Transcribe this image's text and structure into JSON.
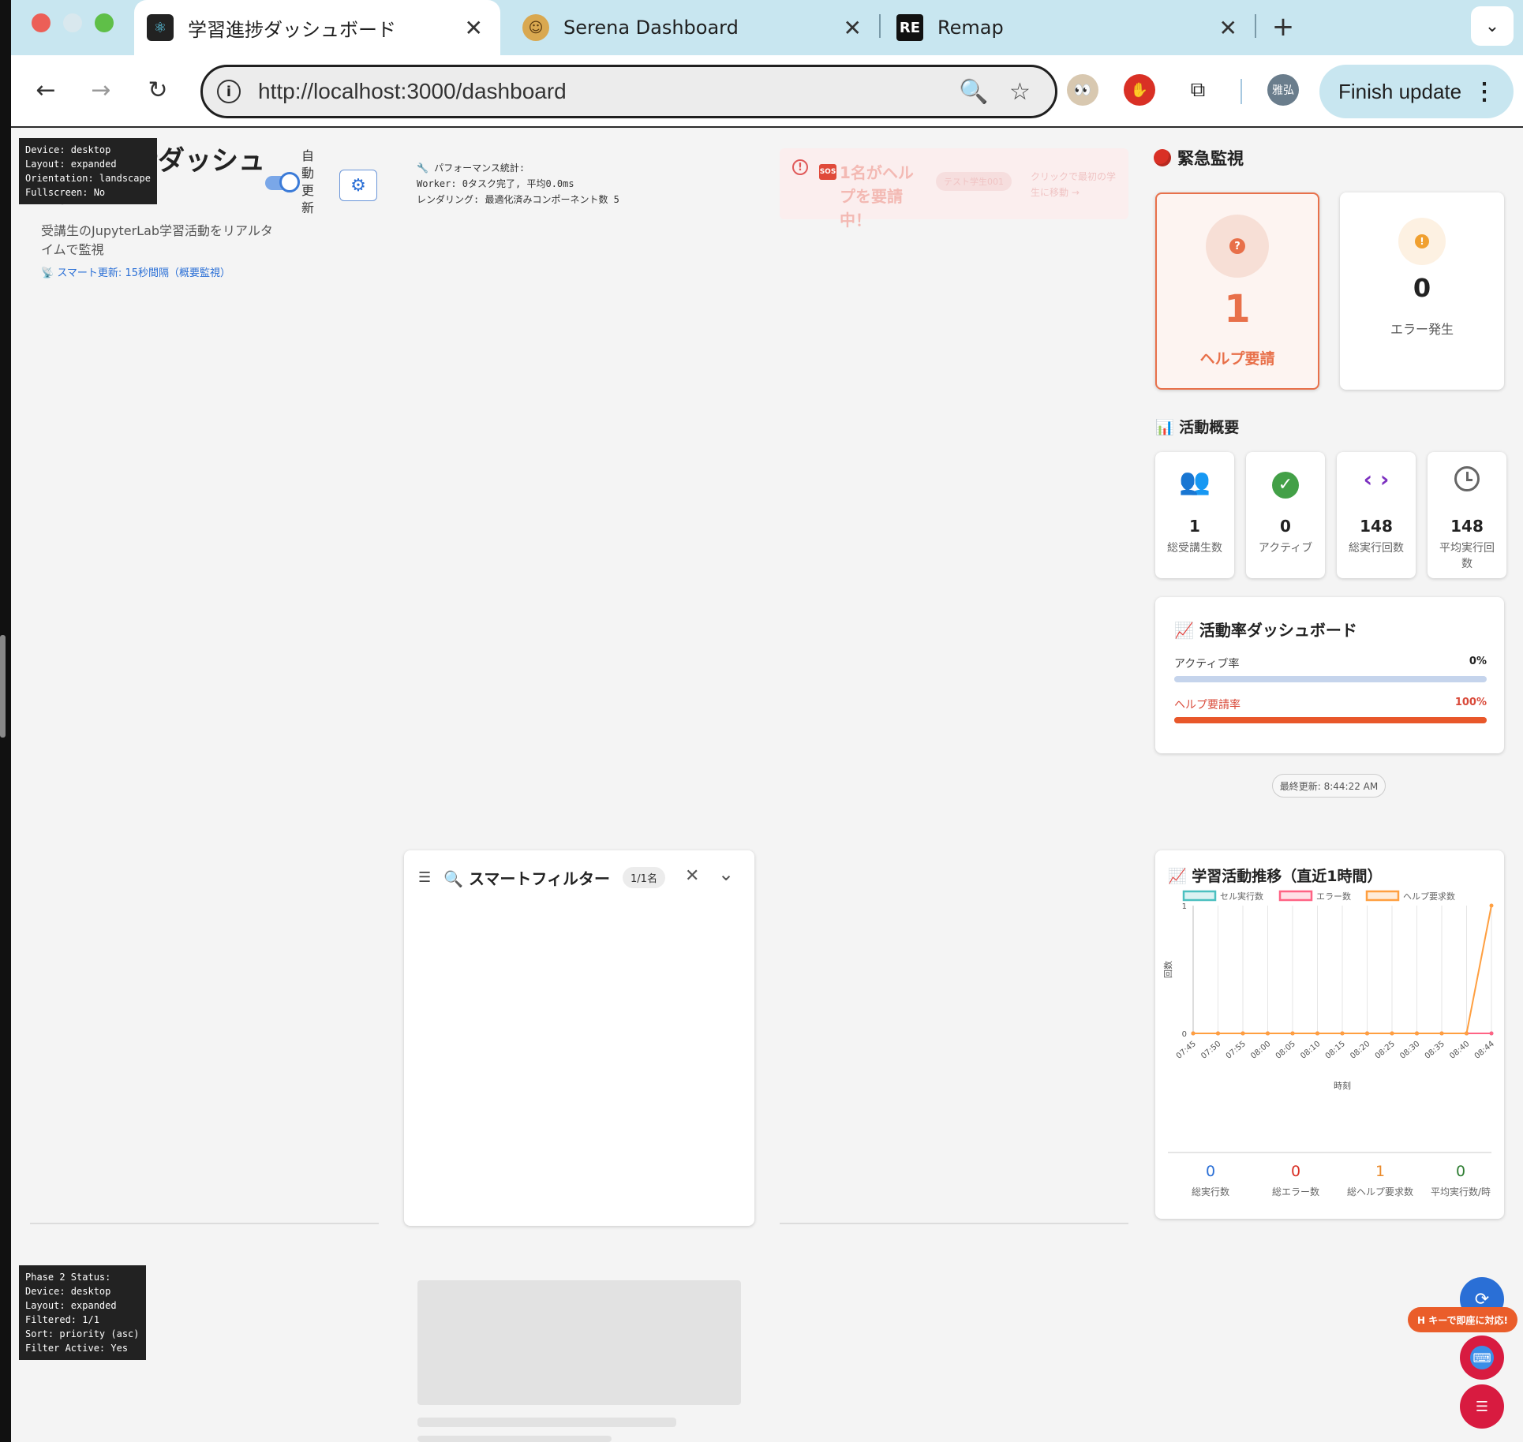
{
  "browser": {
    "tabs": [
      {
        "title": "学習進捗ダッシュボード",
        "active": true
      },
      {
        "title": "Serena Dashboard",
        "active": false
      },
      {
        "title": "Remap",
        "active": false
      }
    ],
    "new_tab": "+",
    "url": "http://localhost:3000/dashboard",
    "profile_initials": "雅弘",
    "finish_update": "Finish update",
    "remap_favicon": "RE"
  },
  "debug_top": "Device: desktop\nLayout: expanded\nOrientation: landscape\nFullscreen: No",
  "debug_bottom": "Phase 2 Status:\nDevice: desktop\nLayout: expanded\nFiltered: 1/1\nSort: priority (asc)\nFilter Active: Yes",
  "header": {
    "title": "学習進捗ダッシュボード",
    "subtitle": "受講生のJupyterLab学習活動をリアルタイムで監視",
    "smart_update": "📡 スマート更新: 15秒間隔（概要監視）",
    "auto_update": "自動更新"
  },
  "perf": "🔧 パフォーマンス統計:\nWorker: 0タスク完了, 平均0.0ms\nレンダリング: 最適化済みコンポーネント数 5",
  "alert": {
    "message": "1名がヘルプを要請中！",
    "student_chip": "テスト学生001",
    "hint": "クリックで最初の学生に移動 →"
  },
  "emergency": {
    "title": "緊急監視",
    "help_count": "1",
    "help_label": "ヘルプ要請",
    "error_count": "0",
    "error_label": "エラー発生"
  },
  "activity": {
    "title": "📊 活動概要",
    "stats": [
      {
        "value": "1",
        "label": "総受講生数",
        "icon": "people-icon",
        "color": "#3b6fd6"
      },
      {
        "value": "0",
        "label": "アクティブ",
        "icon": "check-circle-icon",
        "color": "#43a047"
      },
      {
        "value": "148",
        "label": "総実行回数",
        "icon": "code-icon",
        "color": "#7b2fbf"
      },
      {
        "value": "148",
        "label": "平均実行回数",
        "icon": "clock-icon",
        "color": "#666666"
      }
    ]
  },
  "rate_dashboard": {
    "title": "📈 活動率ダッシュボード",
    "active_label": "アクティブ率",
    "active_value": "0%",
    "active_fraction": 0,
    "help_label": "ヘルプ要請率",
    "help_value": "100%",
    "help_fraction": 1
  },
  "last_updated": "最終更新: 8:44:22 AM",
  "filter": {
    "title": "🔍 スマートフィルター",
    "badge": "1/1名"
  },
  "h_key_hint": "H キーで即座に対応!",
  "chart_panel": {
    "title": "📈 学習活動推移（直近1時間）",
    "summary": [
      {
        "value": "0",
        "label": "総実行数",
        "color": "#2a6fd6"
      },
      {
        "value": "0",
        "label": "総エラー数",
        "color": "#d93025"
      },
      {
        "value": "1",
        "label": "総ヘルプ要求数",
        "color": "#ea8a2a"
      },
      {
        "value": "0",
        "label": "平均実行数/時",
        "color": "#2e7d32"
      }
    ]
  },
  "chart_data": {
    "type": "line",
    "x": [
      "07:45",
      "07:50",
      "07:55",
      "08:00",
      "08:05",
      "08:10",
      "08:15",
      "08:20",
      "08:25",
      "08:30",
      "08:35",
      "08:40",
      "08:44"
    ],
    "series": [
      {
        "name": "セル実行数",
        "color": "#4bc0c0",
        "values": [
          0,
          0,
          0,
          0,
          0,
          0,
          0,
          0,
          0,
          0,
          0,
          0,
          0
        ]
      },
      {
        "name": "エラー数",
        "color": "#ff6384",
        "values": [
          0,
          0,
          0,
          0,
          0,
          0,
          0,
          0,
          0,
          0,
          0,
          0,
          0
        ]
      },
      {
        "name": "ヘルプ要求数",
        "color": "#ff9f40",
        "values": [
          0,
          0,
          0,
          0,
          0,
          0,
          0,
          0,
          0,
          0,
          0,
          0,
          1
        ]
      }
    ],
    "xlabel": "時刻",
    "ylabel": "回数",
    "ylim": [
      0,
      1
    ],
    "yticks": [
      "0",
      "1"
    ],
    "grid": true,
    "legend": "top"
  }
}
